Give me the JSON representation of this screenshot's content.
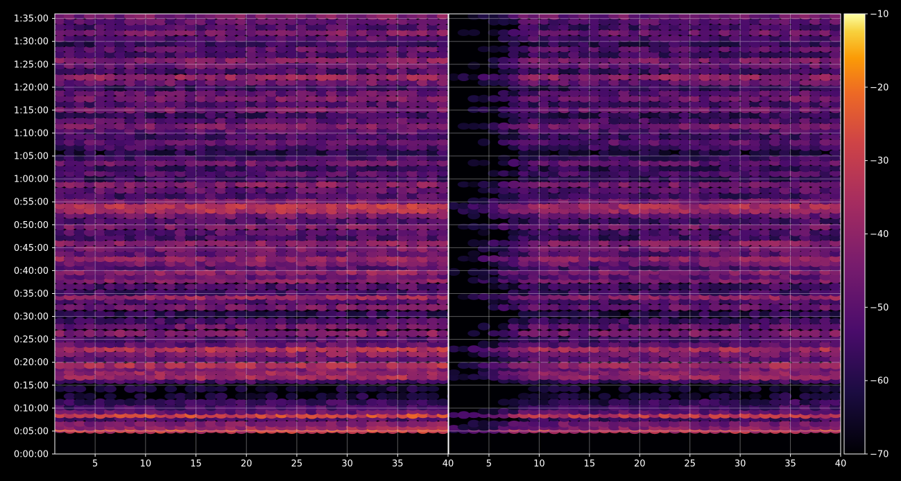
{
  "chart_data": {
    "type": "heatmap",
    "title": "",
    "colormap": "inferno",
    "background": "#000000",
    "grid": true,
    "grid_color": "#ffffff",
    "y_axis": {
      "label": "",
      "range_seconds": [
        0,
        5760
      ],
      "tick_labels": [
        "0:00:00",
        "0:05:00",
        "0:10:00",
        "0:15:00",
        "0:20:00",
        "0:25:00",
        "0:30:00",
        "0:35:00",
        "0:40:00",
        "0:45:00",
        "0:50:00",
        "0:55:00",
        "1:00:00",
        "1:05:00",
        "1:10:00",
        "1:15:00",
        "1:20:00",
        "1:25:00",
        "1:30:00",
        "1:35:00"
      ]
    },
    "colorbar": {
      "range": [
        -70,
        -10
      ],
      "tick_labels": [
        "-70",
        "-60",
        "-50",
        "-40",
        "-30",
        "-20",
        "-10"
      ],
      "position": "right"
    },
    "panels": [
      {
        "name": "left",
        "x_range": [
          1,
          40
        ],
        "x_tick_labels": [
          "5",
          "10",
          "15",
          "20",
          "25",
          "30",
          "35",
          "40"
        ],
        "bands": [
          {
            "t": 5.2,
            "v": -33
          },
          {
            "t": 5.6,
            "v": -28
          },
          {
            "t": 5.85,
            "v": -40
          },
          {
            "t": 6.6,
            "v": -45
          },
          {
            "t": 7.8,
            "v": -55
          },
          {
            "t": 8.5,
            "v": -30
          },
          {
            "t": 9.3,
            "v": -50
          },
          {
            "t": 10.2,
            "v": -55
          },
          {
            "t": 11.3,
            "v": -58
          },
          {
            "t": 12.6,
            "v": -65
          },
          {
            "t": 14.2,
            "v": -65
          },
          {
            "t": 16.0,
            "v": -56
          },
          {
            "t": 16.8,
            "v": -38
          },
          {
            "t": 17.8,
            "v": -40
          },
          {
            "t": 18.7,
            "v": -45
          },
          {
            "t": 19.3,
            "v": -36
          },
          {
            "t": 20.7,
            "v": -50
          },
          {
            "t": 21.8,
            "v": -44
          },
          {
            "t": 22.9,
            "v": -35
          },
          {
            "t": 23.9,
            "v": -50
          },
          {
            "t": 25.0,
            "v": -54
          },
          {
            "t": 26.3,
            "v": -44
          },
          {
            "t": 27.8,
            "v": -48
          },
          {
            "t": 29.0,
            "v": -55
          },
          {
            "t": 30.5,
            "v": -60
          },
          {
            "t": 32.0,
            "v": -47
          },
          {
            "t": 33.3,
            "v": -52
          },
          {
            "t": 34.3,
            "v": -40
          },
          {
            "t": 35.2,
            "v": -56
          },
          {
            "t": 36.5,
            "v": -54
          },
          {
            "t": 37.9,
            "v": -44
          },
          {
            "t": 38.7,
            "v": -49
          },
          {
            "t": 39.7,
            "v": -42
          },
          {
            "t": 40.7,
            "v": -53
          },
          {
            "t": 41.6,
            "v": -46
          },
          {
            "t": 42.6,
            "v": -40
          },
          {
            "t": 43.7,
            "v": -50
          },
          {
            "t": 44.8,
            "v": -46
          },
          {
            "t": 46.0,
            "v": -42
          },
          {
            "t": 47.2,
            "v": -55
          },
          {
            "t": 48.3,
            "v": -52
          },
          {
            "t": 49.6,
            "v": -45
          },
          {
            "t": 50.8,
            "v": -54
          },
          {
            "t": 52.0,
            "v": -47
          },
          {
            "t": 53.1,
            "v": -36
          },
          {
            "t": 54.1,
            "v": -34
          },
          {
            "t": 55.2,
            "v": -46
          },
          {
            "t": 56.3,
            "v": -55
          },
          {
            "t": 57.5,
            "v": -50
          },
          {
            "t": 58.8,
            "v": -44
          },
          {
            "t": 60.0,
            "v": -58
          },
          {
            "t": 61.2,
            "v": -52
          },
          {
            "t": 62.3,
            "v": -58
          },
          {
            "t": 63.5,
            "v": -48
          },
          {
            "t": 64.6,
            "v": -56
          },
          {
            "t": 65.7,
            "v": -62
          },
          {
            "t": 66.9,
            "v": -56
          },
          {
            "t": 68.0,
            "v": -50
          },
          {
            "t": 69.2,
            "v": -56
          },
          {
            "t": 70.4,
            "v": -52
          },
          {
            "t": 71.5,
            "v": -44
          },
          {
            "t": 72.7,
            "v": -52
          },
          {
            "t": 73.9,
            "v": -58
          },
          {
            "t": 75.1,
            "v": -46
          },
          {
            "t": 76.3,
            "v": -54
          },
          {
            "t": 77.5,
            "v": -46
          },
          {
            "t": 78.7,
            "v": -50
          },
          {
            "t": 79.9,
            "v": -58
          },
          {
            "t": 81.0,
            "v": -48
          },
          {
            "t": 82.2,
            "v": -40
          },
          {
            "t": 83.5,
            "v": -55
          },
          {
            "t": 84.7,
            "v": -48
          },
          {
            "t": 85.9,
            "v": -44
          },
          {
            "t": 87.1,
            "v": -54
          },
          {
            "t": 88.3,
            "v": -50
          },
          {
            "t": 89.5,
            "v": -58
          },
          {
            "t": 90.6,
            "v": -52
          },
          {
            "t": 91.9,
            "v": -46
          },
          {
            "t": 93.1,
            "v": -54
          },
          {
            "t": 94.3,
            "v": -50
          },
          {
            "t": 95.5,
            "v": -46
          }
        ]
      },
      {
        "name": "right",
        "x_range": [
          1,
          40
        ],
        "x_tick_labels": [
          "5",
          "10",
          "15",
          "20",
          "25",
          "30",
          "35",
          "40"
        ],
        "bands": [
          {
            "t": 5.2,
            "v": -36
          },
          {
            "t": 5.6,
            "v": -32
          },
          {
            "t": 5.85,
            "v": -44
          },
          {
            "t": 6.6,
            "v": -48
          },
          {
            "t": 7.8,
            "v": -58
          },
          {
            "t": 8.5,
            "v": -34
          },
          {
            "t": 9.3,
            "v": -52
          },
          {
            "t": 10.2,
            "v": -57
          },
          {
            "t": 11.3,
            "v": -60
          },
          {
            "t": 12.6,
            "v": -66
          },
          {
            "t": 14.2,
            "v": -66
          },
          {
            "t": 16.0,
            "v": -58
          },
          {
            "t": 16.8,
            "v": -42
          },
          {
            "t": 17.8,
            "v": -44
          },
          {
            "t": 18.7,
            "v": -48
          },
          {
            "t": 19.3,
            "v": -40
          },
          {
            "t": 20.7,
            "v": -52
          },
          {
            "t": 21.8,
            "v": -47
          },
          {
            "t": 22.9,
            "v": -38
          },
          {
            "t": 23.9,
            "v": -53
          },
          {
            "t": 25.0,
            "v": -56
          },
          {
            "t": 26.3,
            "v": -47
          },
          {
            "t": 27.8,
            "v": -51
          },
          {
            "t": 29.0,
            "v": -58
          },
          {
            "t": 30.5,
            "v": -62
          },
          {
            "t": 32.0,
            "v": -50
          },
          {
            "t": 33.3,
            "v": -55
          },
          {
            "t": 34.3,
            "v": -43
          },
          {
            "t": 35.2,
            "v": -58
          },
          {
            "t": 36.5,
            "v": -57
          },
          {
            "t": 37.9,
            "v": -47
          },
          {
            "t": 38.7,
            "v": -52
          },
          {
            "t": 39.7,
            "v": -45
          },
          {
            "t": 40.7,
            "v": -56
          },
          {
            "t": 41.6,
            "v": -49
          },
          {
            "t": 42.6,
            "v": -43
          },
          {
            "t": 43.7,
            "v": -53
          },
          {
            "t": 44.8,
            "v": -49
          },
          {
            "t": 46.0,
            "v": -45
          },
          {
            "t": 47.2,
            "v": -58
          },
          {
            "t": 48.3,
            "v": -55
          },
          {
            "t": 49.6,
            "v": -48
          },
          {
            "t": 50.8,
            "v": -57
          },
          {
            "t": 52.0,
            "v": -50
          },
          {
            "t": 53.1,
            "v": -40
          },
          {
            "t": 54.1,
            "v": -38
          },
          {
            "t": 55.2,
            "v": -49
          },
          {
            "t": 56.3,
            "v": -58
          },
          {
            "t": 57.5,
            "v": -53
          },
          {
            "t": 58.8,
            "v": -47
          },
          {
            "t": 60.0,
            "v": -60
          },
          {
            "t": 61.2,
            "v": -55
          },
          {
            "t": 62.3,
            "v": -60
          },
          {
            "t": 63.5,
            "v": -51
          },
          {
            "t": 64.6,
            "v": -58
          },
          {
            "t": 65.7,
            "v": -64
          },
          {
            "t": 66.9,
            "v": -58
          },
          {
            "t": 68.0,
            "v": -53
          },
          {
            "t": 69.2,
            "v": -58
          },
          {
            "t": 70.4,
            "v": -55
          },
          {
            "t": 71.5,
            "v": -47
          },
          {
            "t": 72.7,
            "v": -55
          },
          {
            "t": 73.9,
            "v": -60
          },
          {
            "t": 75.1,
            "v": -49
          },
          {
            "t": 76.3,
            "v": -57
          },
          {
            "t": 77.5,
            "v": -49
          },
          {
            "t": 78.7,
            "v": -53
          },
          {
            "t": 79.9,
            "v": -60
          },
          {
            "t": 81.0,
            "v": -51
          },
          {
            "t": 82.2,
            "v": -43
          },
          {
            "t": 83.5,
            "v": -58
          },
          {
            "t": 84.7,
            "v": -51
          },
          {
            "t": 85.9,
            "v": -47
          },
          {
            "t": 87.1,
            "v": -57
          },
          {
            "t": 88.3,
            "v": -53
          },
          {
            "t": 89.5,
            "v": -60
          },
          {
            "t": 90.6,
            "v": -55
          },
          {
            "t": 91.9,
            "v": -49
          },
          {
            "t": 93.1,
            "v": -57
          },
          {
            "t": 94.3,
            "v": -53
          },
          {
            "t": 95.5,
            "v": -49
          }
        ],
        "dark_region": {
          "x_end": 9,
          "v_min": -70
        }
      }
    ]
  }
}
